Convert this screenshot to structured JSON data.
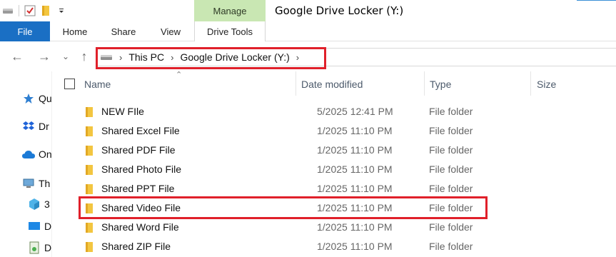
{
  "window": {
    "title": "Google Drive Locker (Y:)",
    "manage_tab": "Manage"
  },
  "ribbon": {
    "tabs": [
      {
        "label": "File"
      },
      {
        "label": "Home"
      },
      {
        "label": "Share"
      },
      {
        "label": "View"
      },
      {
        "label": "Drive Tools"
      }
    ]
  },
  "address": {
    "crumbs": [
      "This PC",
      "Google Drive Locker (Y:)"
    ]
  },
  "navpane": {
    "items": [
      {
        "label": "Qu",
        "icon": "quick-access-star-icon"
      },
      {
        "label": "Dr",
        "icon": "dropbox-icon"
      },
      {
        "label": "On",
        "icon": "onedrive-cloud-icon"
      },
      {
        "label": "Th",
        "icon": "this-pc-icon"
      },
      {
        "label": "3",
        "icon": "3d-objects-icon"
      },
      {
        "label": "D",
        "icon": "desktop-icon"
      },
      {
        "label": "D",
        "icon": "documents-icon"
      }
    ]
  },
  "columns": {
    "name": "Name",
    "date": "Date modified",
    "type": "Type",
    "size": "Size"
  },
  "files": [
    {
      "name": "NEW FIle",
      "date": "5/2025 12:41 PM",
      "type": "File folder"
    },
    {
      "name": "Shared Excel File",
      "date": "1/2025 11:10 PM",
      "type": "File folder"
    },
    {
      "name": "Shared PDF File",
      "date": "1/2025 11:10 PM",
      "type": "File folder"
    },
    {
      "name": "Shared Photo File",
      "date": "1/2025 11:10 PM",
      "type": "File folder"
    },
    {
      "name": "Shared PPT File",
      "date": "1/2025 11:10 PM",
      "type": "File folder"
    },
    {
      "name": "Shared Video File",
      "date": "1/2025 11:10 PM",
      "type": "File folder"
    },
    {
      "name": "Shared Word File",
      "date": "1/2025 11:10 PM",
      "type": "File folder"
    },
    {
      "name": "Shared ZIP File",
      "date": "1/2025 11:10 PM",
      "type": "File folder"
    }
  ],
  "colors": {
    "file_tab": "#1a6fc4",
    "manage_tab": "#c9e7b3",
    "highlight": "#e0202a",
    "folder": "#f3c640"
  }
}
